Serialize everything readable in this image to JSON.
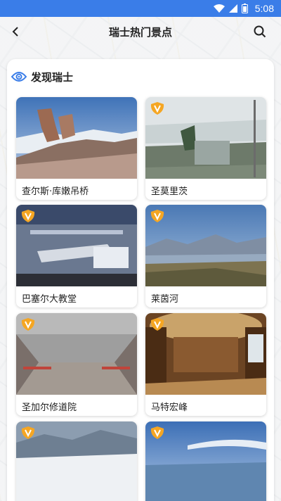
{
  "status": {
    "time": "5:08"
  },
  "header": {
    "title": "瑞士热门景点"
  },
  "section": {
    "title": "发现瑞士"
  },
  "places": [
    {
      "label": "查尔斯·库嫩吊桥",
      "vr": false
    },
    {
      "label": "圣莫里茨",
      "vr": true
    },
    {
      "label": "巴塞尔大教堂",
      "vr": true
    },
    {
      "label": "莱茵河",
      "vr": true
    },
    {
      "label": "圣加尔修道院",
      "vr": true
    },
    {
      "label": "马特宏峰",
      "vr": true
    },
    {
      "label": "",
      "vr": true
    },
    {
      "label": "",
      "vr": true
    }
  ],
  "colors": {
    "status_bar": "#3a7de8",
    "badge": "#f5a623",
    "eye_icon": "#3a7de8"
  },
  "icons": {
    "badge": "vr-badge-icon",
    "section": "eye-icon",
    "back": "back-arrow-icon",
    "search": "search-icon"
  }
}
